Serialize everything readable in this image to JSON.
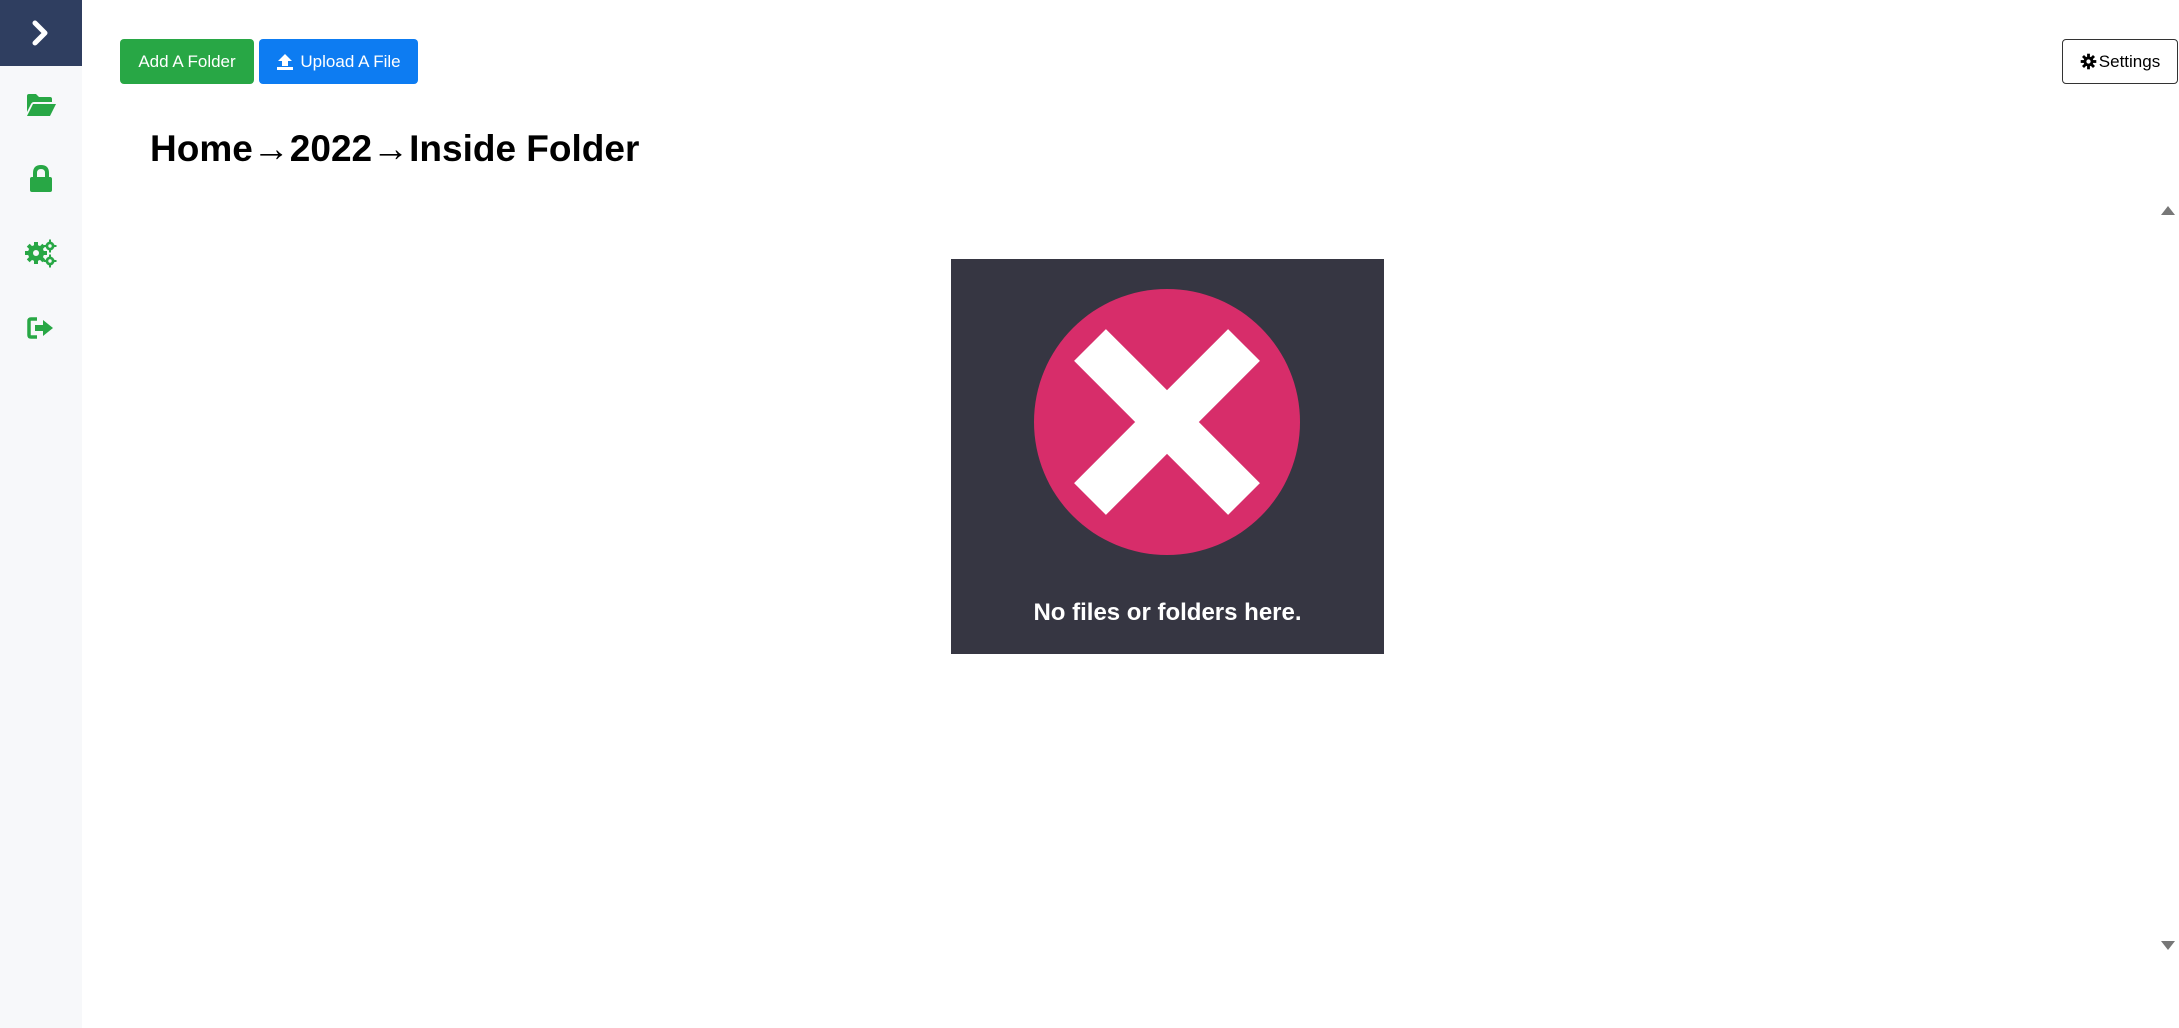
{
  "sidebar": {
    "toggle_icon": "chevron-right-icon",
    "items": [
      {
        "icon": "folder-open-icon"
      },
      {
        "icon": "lock-icon"
      },
      {
        "icon": "gears-icon"
      },
      {
        "icon": "sign-out-icon"
      }
    ],
    "colors": {
      "background": "#f7f8fa",
      "toggle_background": "#2f3e60",
      "icon": "#28a745"
    }
  },
  "toolbar": {
    "add_folder_label": "Add A Folder",
    "upload_label": "Upload A File",
    "upload_icon": "upload-icon",
    "settings_label": "Settings",
    "settings_icon": "gear-icon"
  },
  "breadcrumb": {
    "text": "Home→2022→Inside Folder"
  },
  "empty_state": {
    "icon": "close-icon",
    "message": "No files or folders here.",
    "colors": {
      "card": "#363642",
      "circle": "#d72d6a"
    }
  },
  "colors": {
    "green": "#28a745",
    "blue": "#0d7cf2"
  }
}
